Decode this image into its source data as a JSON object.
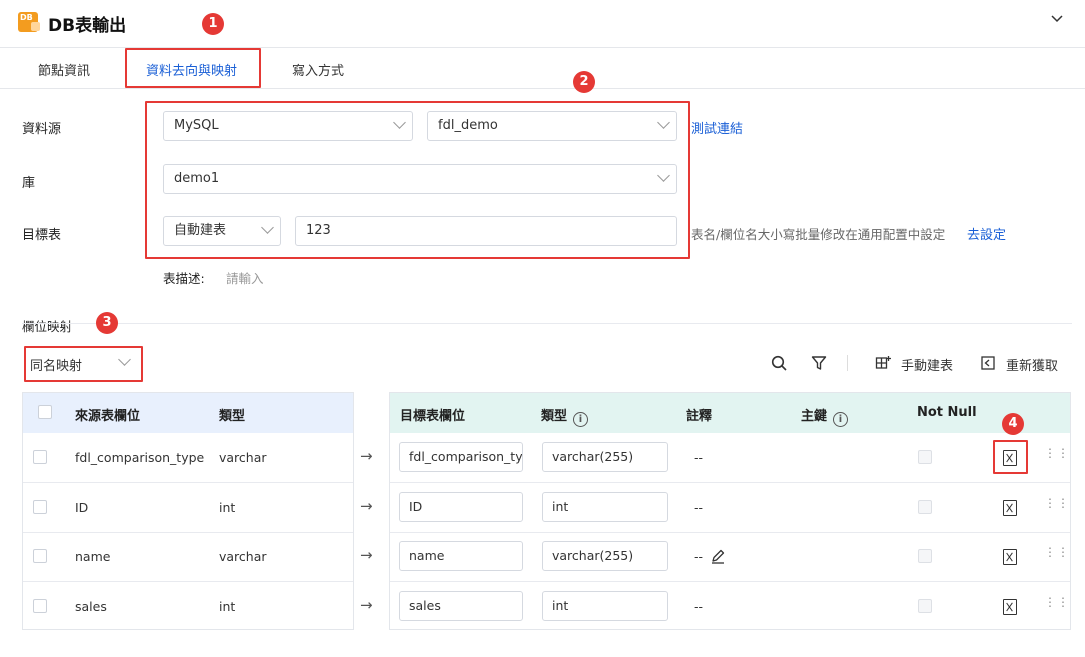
{
  "header": {
    "title": "DB表輸出",
    "app_icon_text": "DB"
  },
  "tabs": [
    {
      "label": "節點資訊"
    },
    {
      "label": "資料去向與映射"
    },
    {
      "label": "寫入方式"
    }
  ],
  "badges": [
    "1",
    "2",
    "3",
    "4"
  ],
  "form": {
    "datasource_label": "資料源",
    "datasource_type": "MySQL",
    "datasource_conn": "fdl_demo",
    "test_link": "測試連結",
    "db_label": "庫",
    "db_value": "demo1",
    "target_label": "目標表",
    "target_mode": "自動建表",
    "target_name": "123",
    "hint": "表名/欄位名大小寫批量修改在通用配置中設定",
    "goto_settings": "去設定",
    "desc_label": "表描述:",
    "desc_placeholder": "請輸入"
  },
  "mapping": {
    "section_title": "欄位映射",
    "mode": "同名映射",
    "manual_create": "手動建表",
    "refresh": "重新獲取"
  },
  "left_table": {
    "headers": [
      "來源表欄位",
      "類型"
    ],
    "rows": [
      {
        "field": "fdl_comparison_type",
        "type": "varchar"
      },
      {
        "field": "ID",
        "type": "int"
      },
      {
        "field": "name",
        "type": "varchar"
      },
      {
        "field": "sales",
        "type": "int"
      }
    ]
  },
  "right_table": {
    "headers": [
      "目標表欄位",
      "類型",
      "註釋",
      "主鍵",
      "Not Null"
    ],
    "rows": [
      {
        "field": "fdl_comparison_ty",
        "type": "varchar(255)",
        "comment": "--"
      },
      {
        "field": "ID",
        "type": "int",
        "comment": "--"
      },
      {
        "field": "name",
        "type": "varchar(255)",
        "comment": "--"
      },
      {
        "field": "sales",
        "type": "int",
        "comment": "--"
      }
    ]
  },
  "colors": {
    "accent": "#1a5fd6",
    "annotation": "#e53935",
    "icon_orange": "#f39c1f"
  }
}
